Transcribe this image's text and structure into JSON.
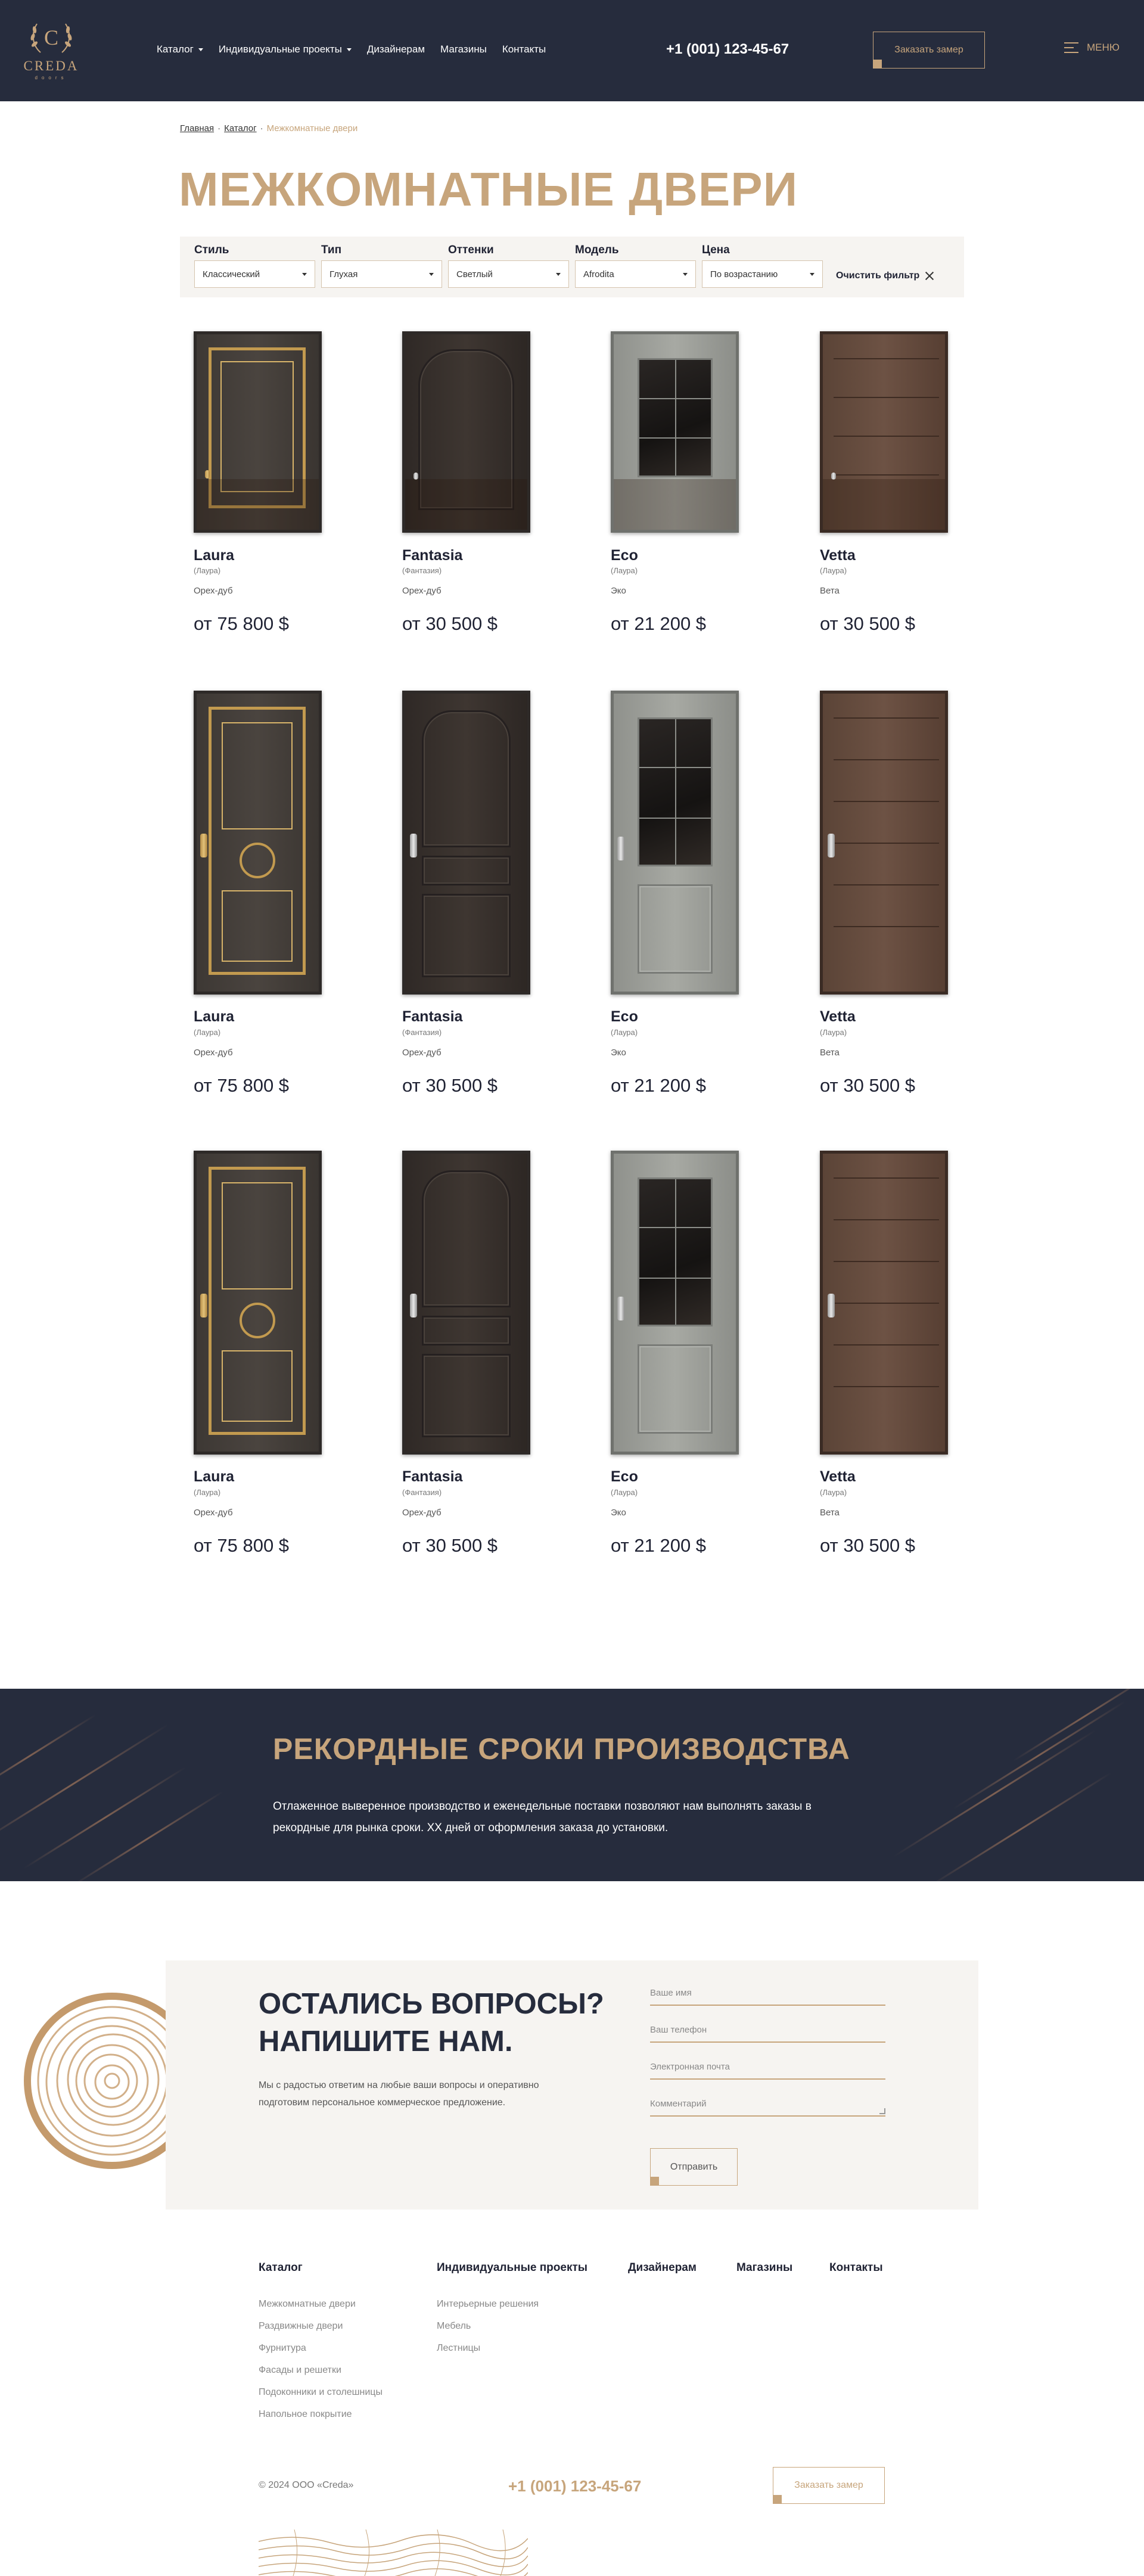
{
  "header": {
    "logo_text": "CREDA",
    "logo_sub": "doors",
    "nav": [
      {
        "label": "Каталог",
        "dropdown": true
      },
      {
        "label": "Индивидуальные проекты",
        "dropdown": true
      },
      {
        "label": "Дизайнерам",
        "dropdown": false
      },
      {
        "label": "Магазины",
        "dropdown": false
      },
      {
        "label": "Контакты",
        "dropdown": false
      }
    ],
    "phone": "+1 (001) 123-45-67",
    "cta_label": "Заказать замер",
    "menu_label": "МЕНЮ"
  },
  "breadcrumb": {
    "home": "Главная",
    "catalog": "Каталог",
    "current": "Межкомнатные двери"
  },
  "page_title": "МЕЖКОМНАТНЫЕ ДВЕРИ",
  "filters": {
    "items": [
      {
        "label": "Стиль",
        "value": "Классический"
      },
      {
        "label": "Тип",
        "value": "Глухая"
      },
      {
        "label": "Оттенки",
        "value": "Светлый"
      },
      {
        "label": "Модель",
        "value": "Afrodita"
      },
      {
        "label": "Цена",
        "value": "По возрастанию"
      }
    ],
    "clear_label": "Очистить фильтр"
  },
  "products": [
    {
      "name": "Laura",
      "sub": "(Лаура)",
      "material": "Орех-дуб",
      "price": "от 75 800 $"
    },
    {
      "name": "Fantasia",
      "sub": "(Фантазия)",
      "material": "Орех-дуб",
      "price": "от 30 500 $"
    },
    {
      "name": "Eco",
      "sub": "(Лаура)",
      "material": "Эко",
      "price": "от 21 200 $"
    },
    {
      "name": "Vetta",
      "sub": "(Лаура)",
      "material": "Вета",
      "price": "от 30 500 $"
    },
    {
      "name": "Laura",
      "sub": "(Лаура)",
      "material": "Орех-дуб",
      "price": "от 75 800 $"
    },
    {
      "name": "Fantasia",
      "sub": "(Фантазия)",
      "material": "Орех-дуб",
      "price": "от 30 500 $"
    },
    {
      "name": "Eco",
      "sub": "(Лаура)",
      "material": "Эко",
      "price": "от 21 200 $"
    },
    {
      "name": "Vetta",
      "sub": "(Лаура)",
      "material": "Вета",
      "price": "от 30 500 $"
    },
    {
      "name": "Laura",
      "sub": "(Лаура)",
      "material": "Орех-дуб",
      "price": "от 75 800 $"
    },
    {
      "name": "Fantasia",
      "sub": "(Фантазия)",
      "material": "Орех-дуб",
      "price": "от 30 500 $"
    },
    {
      "name": "Eco",
      "sub": "(Лаура)",
      "material": "Эко",
      "price": "от 21 200 $"
    },
    {
      "name": "Vetta",
      "sub": "(Лаура)",
      "material": "Вета",
      "price": "от 30 500 $"
    }
  ],
  "banner": {
    "title": "РЕКОРДНЫЕ СРОКИ ПРОИЗВОДСТВА",
    "text": "Отлаженное выверенное производство и еженедельные поставки позволяют нам выполнять заказы в рекордные для рынка сроки. XX дней от оформления заказа до установки."
  },
  "questions": {
    "title_line1": "ОСТАЛИСЬ ВОПРОСЫ?",
    "title_line2": "НАПИШИТЕ НАМ.",
    "text": "Мы с радостью ответим на любые ваши вопросы и оперативно подготовим персональное коммерческое предложение.",
    "fields": {
      "name": "Ваше имя",
      "phone": "Ваш телефон",
      "email": "Электронная почта",
      "comment": "Комментарий"
    },
    "submit": "Отправить"
  },
  "footer": {
    "columns": [
      {
        "title": "Каталог",
        "links": [
          "Межкомнатные двери",
          "Раздвижные двери",
          "Фурнитура",
          "Фасады и решетки",
          "Подоконники и столешницы",
          "Напольное покрытие"
        ]
      },
      {
        "title": "Индивидуальные проекты",
        "links": [
          "Интерьерные решения",
          "Мебель",
          "Лестницы"
        ]
      },
      {
        "title": "Дизайнерам",
        "links": []
      },
      {
        "title": "Магазины",
        "links": []
      },
      {
        "title": "Контакты",
        "links": []
      }
    ],
    "copyright": "© 2024 ООО «Creda»",
    "phone": "+1 (001) 123-45-67",
    "cta_label": "Заказать замер"
  },
  "colors": {
    "navy": "#262c3d",
    "gold": "#c7a57c",
    "light_bg": "#f6f4f1"
  }
}
